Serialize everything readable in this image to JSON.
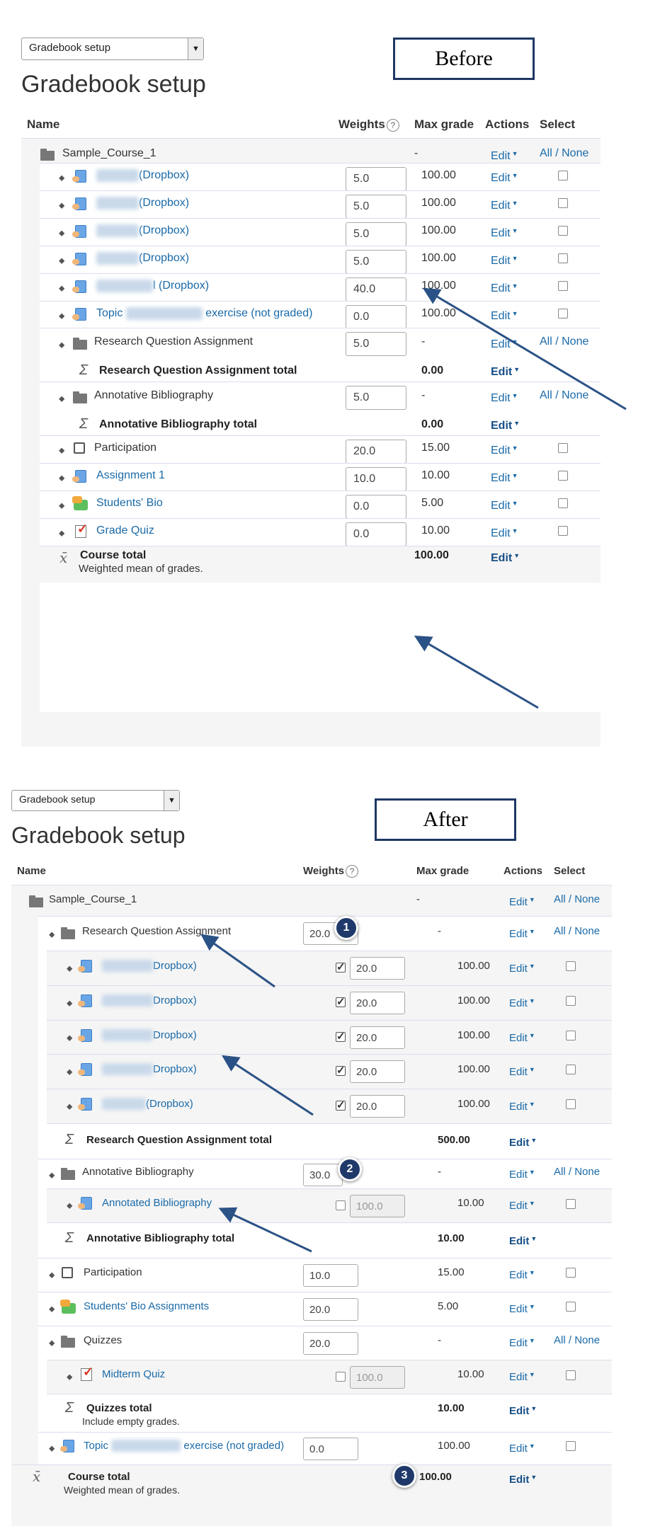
{
  "accent_color": "#1f3864",
  "link_color": "#1a6aa8",
  "before": {
    "dropdown": "Gradebook setup",
    "title": "Gradebook setup",
    "callout": "Before",
    "headers": {
      "name": "Name",
      "weights": "Weights",
      "max_grade": "Max grade",
      "actions": "Actions",
      "select": "Select"
    },
    "course": {
      "name": "Sample_Course_1",
      "max": "-",
      "edit": "Edit",
      "all": "All",
      "sep": " / ",
      "none": "None"
    },
    "items": [
      {
        "name": "(Dropbox)",
        "weight": "5.0",
        "max": "100.00",
        "edit": "Edit"
      },
      {
        "name": "(Dropbox)",
        "weight": "5.0",
        "max": "100.00",
        "edit": "Edit"
      },
      {
        "name": "(Dropbox)",
        "weight": "5.0",
        "max": "100.00",
        "edit": "Edit"
      },
      {
        "name": "(Dropbox)",
        "weight": "5.0",
        "max": "100.00",
        "edit": "Edit"
      },
      {
        "name": "l (Dropbox)",
        "weight": "40.0",
        "max": "100.00",
        "edit": "Edit"
      },
      {
        "name_pre": "Topic",
        "name_post": "exercise (not graded)",
        "weight": "0.0",
        "max": "100.00",
        "edit": "Edit"
      }
    ],
    "rqa": {
      "name": "Research Question Assignment",
      "weight": "5.0",
      "max": "-",
      "edit": "Edit",
      "all": "All",
      "sep": " / ",
      "none": "None"
    },
    "rqa_total": {
      "name": "Research Question Assignment total",
      "max": "0.00",
      "edit": "Edit"
    },
    "ab": {
      "name": "Annotative Bibliography",
      "weight": "5.0",
      "max": "-",
      "edit": "Edit",
      "all": "All",
      "sep": " / ",
      "none": "None"
    },
    "ab_total": {
      "name": "Annotative Bibliography total",
      "max": "0.00",
      "edit": "Edit"
    },
    "participation": {
      "name": "Participation",
      "weight": "20.0",
      "max": "15.00",
      "edit": "Edit"
    },
    "assign1": {
      "name": "Assignment 1",
      "weight": "10.0",
      "max": "10.00",
      "edit": "Edit"
    },
    "bio": {
      "name": "Students' Bio",
      "weight": "0.0",
      "max": "5.00",
      "edit": "Edit"
    },
    "quiz": {
      "name": "Grade Quiz",
      "weight": "0.0",
      "max": "10.00",
      "edit": "Edit"
    },
    "total": {
      "name": "Course total",
      "sub": "Weighted mean of grades.",
      "max": "100.00",
      "edit": "Edit"
    }
  },
  "after": {
    "dropdown": "Gradebook setup",
    "title": "Gradebook setup",
    "callout": "After",
    "headers": {
      "name": "Name",
      "weights": "Weights",
      "max_grade": "Max grade",
      "actions": "Actions",
      "select": "Select"
    },
    "course": {
      "name": "Sample_Course_1",
      "max": "-",
      "edit": "Edit",
      "all": "All",
      "sep": " / ",
      "none": "None"
    },
    "rqa": {
      "name": "Research Question Assignment",
      "weight": "20.0",
      "max": "-",
      "edit": "Edit",
      "all": "All",
      "sep": " / ",
      "none": "None",
      "badge": "1"
    },
    "rqa_items": [
      {
        "name": "Dropbox)",
        "weight": "20.0",
        "max": "100.00",
        "edit": "Edit"
      },
      {
        "name": "Dropbox)",
        "weight": "20.0",
        "max": "100.00",
        "edit": "Edit"
      },
      {
        "name": "Dropbox)",
        "weight": "20.0",
        "max": "100.00",
        "edit": "Edit"
      },
      {
        "name": "Dropbox)",
        "weight": "20.0",
        "max": "100.00",
        "edit": "Edit"
      },
      {
        "name": "(Dropbox)",
        "weight": "20.0",
        "max": "100.00",
        "edit": "Edit"
      }
    ],
    "rqa_total": {
      "name": "Research Question Assignment total",
      "max": "500.00",
      "edit": "Edit"
    },
    "ab": {
      "name": "Annotative Bibliography",
      "weight": "30.0",
      "max": "-",
      "edit": "Edit",
      "all": "All",
      "sep": " / ",
      "none": "None",
      "badge": "2"
    },
    "ab_item": {
      "name": "Annotated Bibliography",
      "weight": "100.0",
      "max": "10.00",
      "edit": "Edit"
    },
    "ab_total": {
      "name": "Annotative Bibliography total",
      "max": "10.00",
      "edit": "Edit"
    },
    "participation": {
      "name": "Participation",
      "weight": "10.0",
      "max": "15.00",
      "edit": "Edit"
    },
    "bio": {
      "name": "Students' Bio Assignments",
      "weight": "20.0",
      "max": "5.00",
      "edit": "Edit"
    },
    "quizzes": {
      "name": "Quizzes",
      "weight": "20.0",
      "max": "-",
      "edit": "Edit",
      "all": "All",
      "sep": " / ",
      "none": "None"
    },
    "midterm": {
      "name": "Midterm Quiz",
      "weight": "100.0",
      "max": "10.00",
      "edit": "Edit"
    },
    "quizzes_total": {
      "name": "Quizzes total",
      "sub": "Include empty grades.",
      "max": "10.00",
      "edit": "Edit"
    },
    "topic": {
      "name_pre": "Topic",
      "name_post": "exercise (not graded)",
      "weight": "0.0",
      "max": "100.00",
      "edit": "Edit"
    },
    "total": {
      "name": "Course total",
      "sub": "Weighted mean of grades.",
      "max": "100.00",
      "edit": "Edit",
      "badge": "3"
    }
  }
}
